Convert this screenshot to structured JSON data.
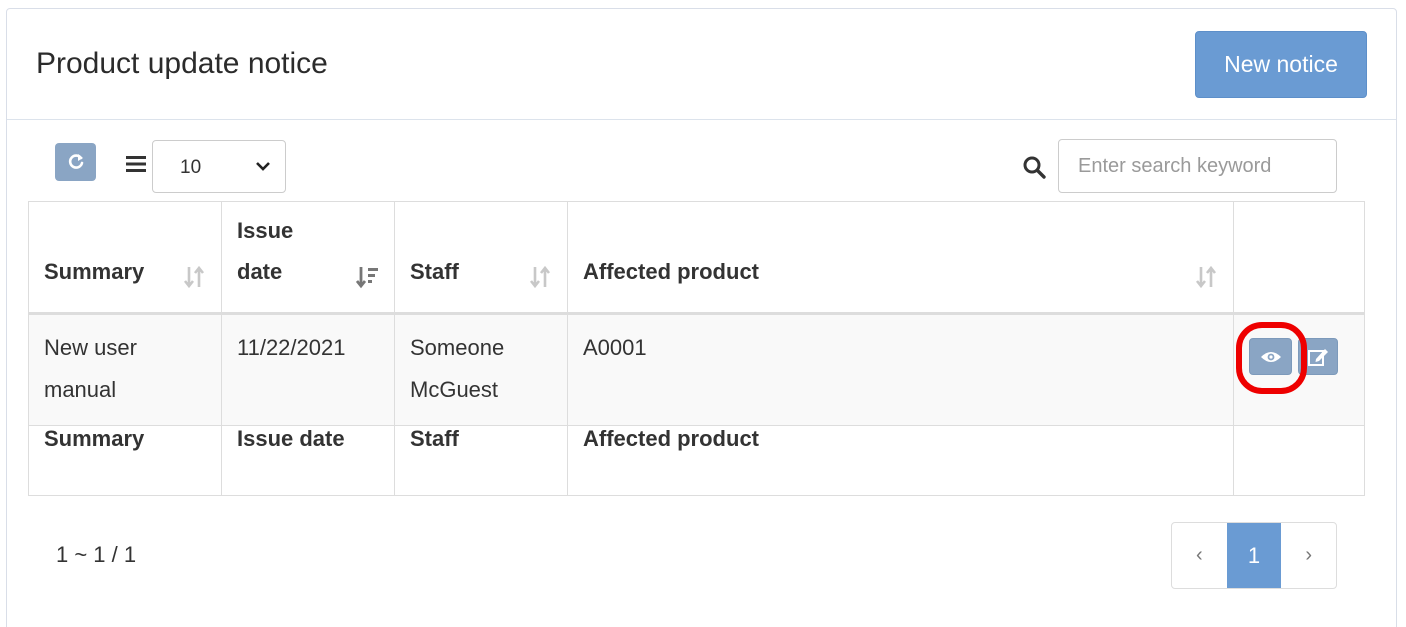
{
  "header": {
    "title": "Product update notice",
    "new_button_label": "New notice"
  },
  "toolbar": {
    "refresh_icon": "refresh-icon",
    "list_icon": "list-icon",
    "page_size": "10",
    "search_icon": "search-icon",
    "search_placeholder": "Enter search keyword"
  },
  "table": {
    "columns": [
      {
        "key": "summary",
        "label": "Summary",
        "footer_label": "Summary",
        "sort_icon": "sort-icon"
      },
      {
        "key": "issue_date",
        "label": "Issue date",
        "footer_label": "Issue date",
        "sort_icon": "sort-desc-icon"
      },
      {
        "key": "staff",
        "label": "Staff",
        "footer_label": "Staff",
        "sort_icon": "sort-icon"
      },
      {
        "key": "affected_product",
        "label": "Affected product",
        "footer_label": "Affected product",
        "sort_icon": "sort-icon"
      }
    ],
    "rows": [
      {
        "summary": "New user manual",
        "issue_date": "11/22/2021",
        "staff": "Someone McGuest",
        "affected_product": "A0001",
        "actions": [
          "eye-icon",
          "edit-icon"
        ]
      }
    ]
  },
  "pagination": {
    "range_text": "1 ~ 1 / 1",
    "prev": "‹",
    "current": "1",
    "next": "›"
  },
  "colors": {
    "primary": "#6a9bd3",
    "action_button": "#8aa5c4",
    "highlight": "#ee0000"
  }
}
